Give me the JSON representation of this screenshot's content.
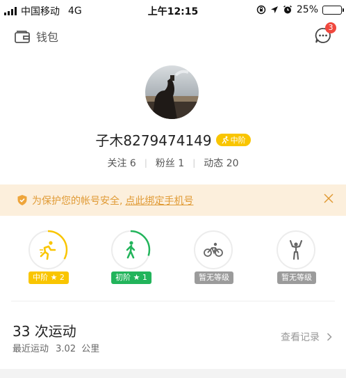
{
  "status_bar": {
    "carrier": "中国移动",
    "network": "4G",
    "time": "上午12:15",
    "battery": "25%",
    "battery_fraction": 0.25
  },
  "topnav": {
    "wallet_label": "钱包",
    "message_badge": "3"
  },
  "profile": {
    "username": "子木8279474149",
    "level_chip": "中阶",
    "following": "关注 6",
    "fans": "粉丝 1",
    "posts": "动态 20"
  },
  "banner": {
    "text": "为保护您的帐号安全,",
    "link": "点此绑定手机号"
  },
  "levels": [
    {
      "icon": "running-icon",
      "label": "中阶 ★ 2",
      "color": "#f9c500",
      "progress": 0.33
    },
    {
      "icon": "walking-icon",
      "label": "初阶 ★ 1",
      "color": "#22b45b",
      "progress": 0.3
    },
    {
      "icon": "cycling-icon",
      "label": "暂无等级",
      "color": "#9b9b9b",
      "progress": 0
    },
    {
      "icon": "fitness-icon",
      "label": "暂无等级",
      "color": "#9b9b9b",
      "progress": 0
    }
  ],
  "summary": {
    "count": "33",
    "count_unit": "次运动",
    "recent_prefix": "最近运动",
    "recent_distance": "3.02",
    "recent_unit": "公里",
    "records_label": "查看记录"
  }
}
